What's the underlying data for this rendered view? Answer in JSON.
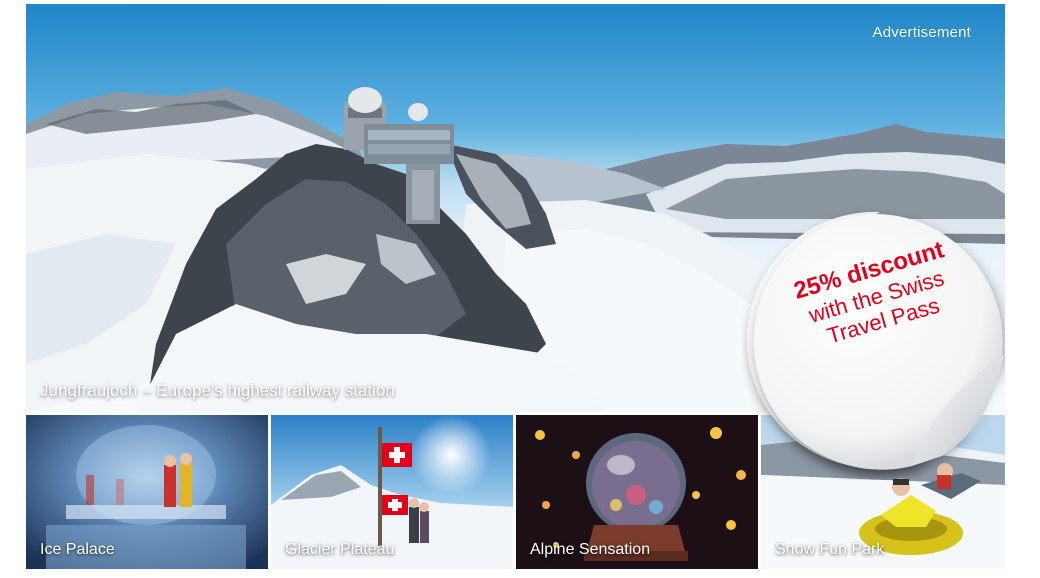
{
  "ad": {
    "label": "Advertisement",
    "hero_caption": "Jungfraujoch – Europe's highest railway station",
    "sticker": {
      "line1": "25% discount",
      "line2": "with the Swiss",
      "line3": "Travel Pass",
      "text_color": "#e2001a"
    },
    "thumbnails": [
      {
        "label": "Ice Palace"
      },
      {
        "label": "Glacier Plateau"
      },
      {
        "label": "Alpine Sensation"
      },
      {
        "label": "Snow Fun Park"
      }
    ]
  }
}
